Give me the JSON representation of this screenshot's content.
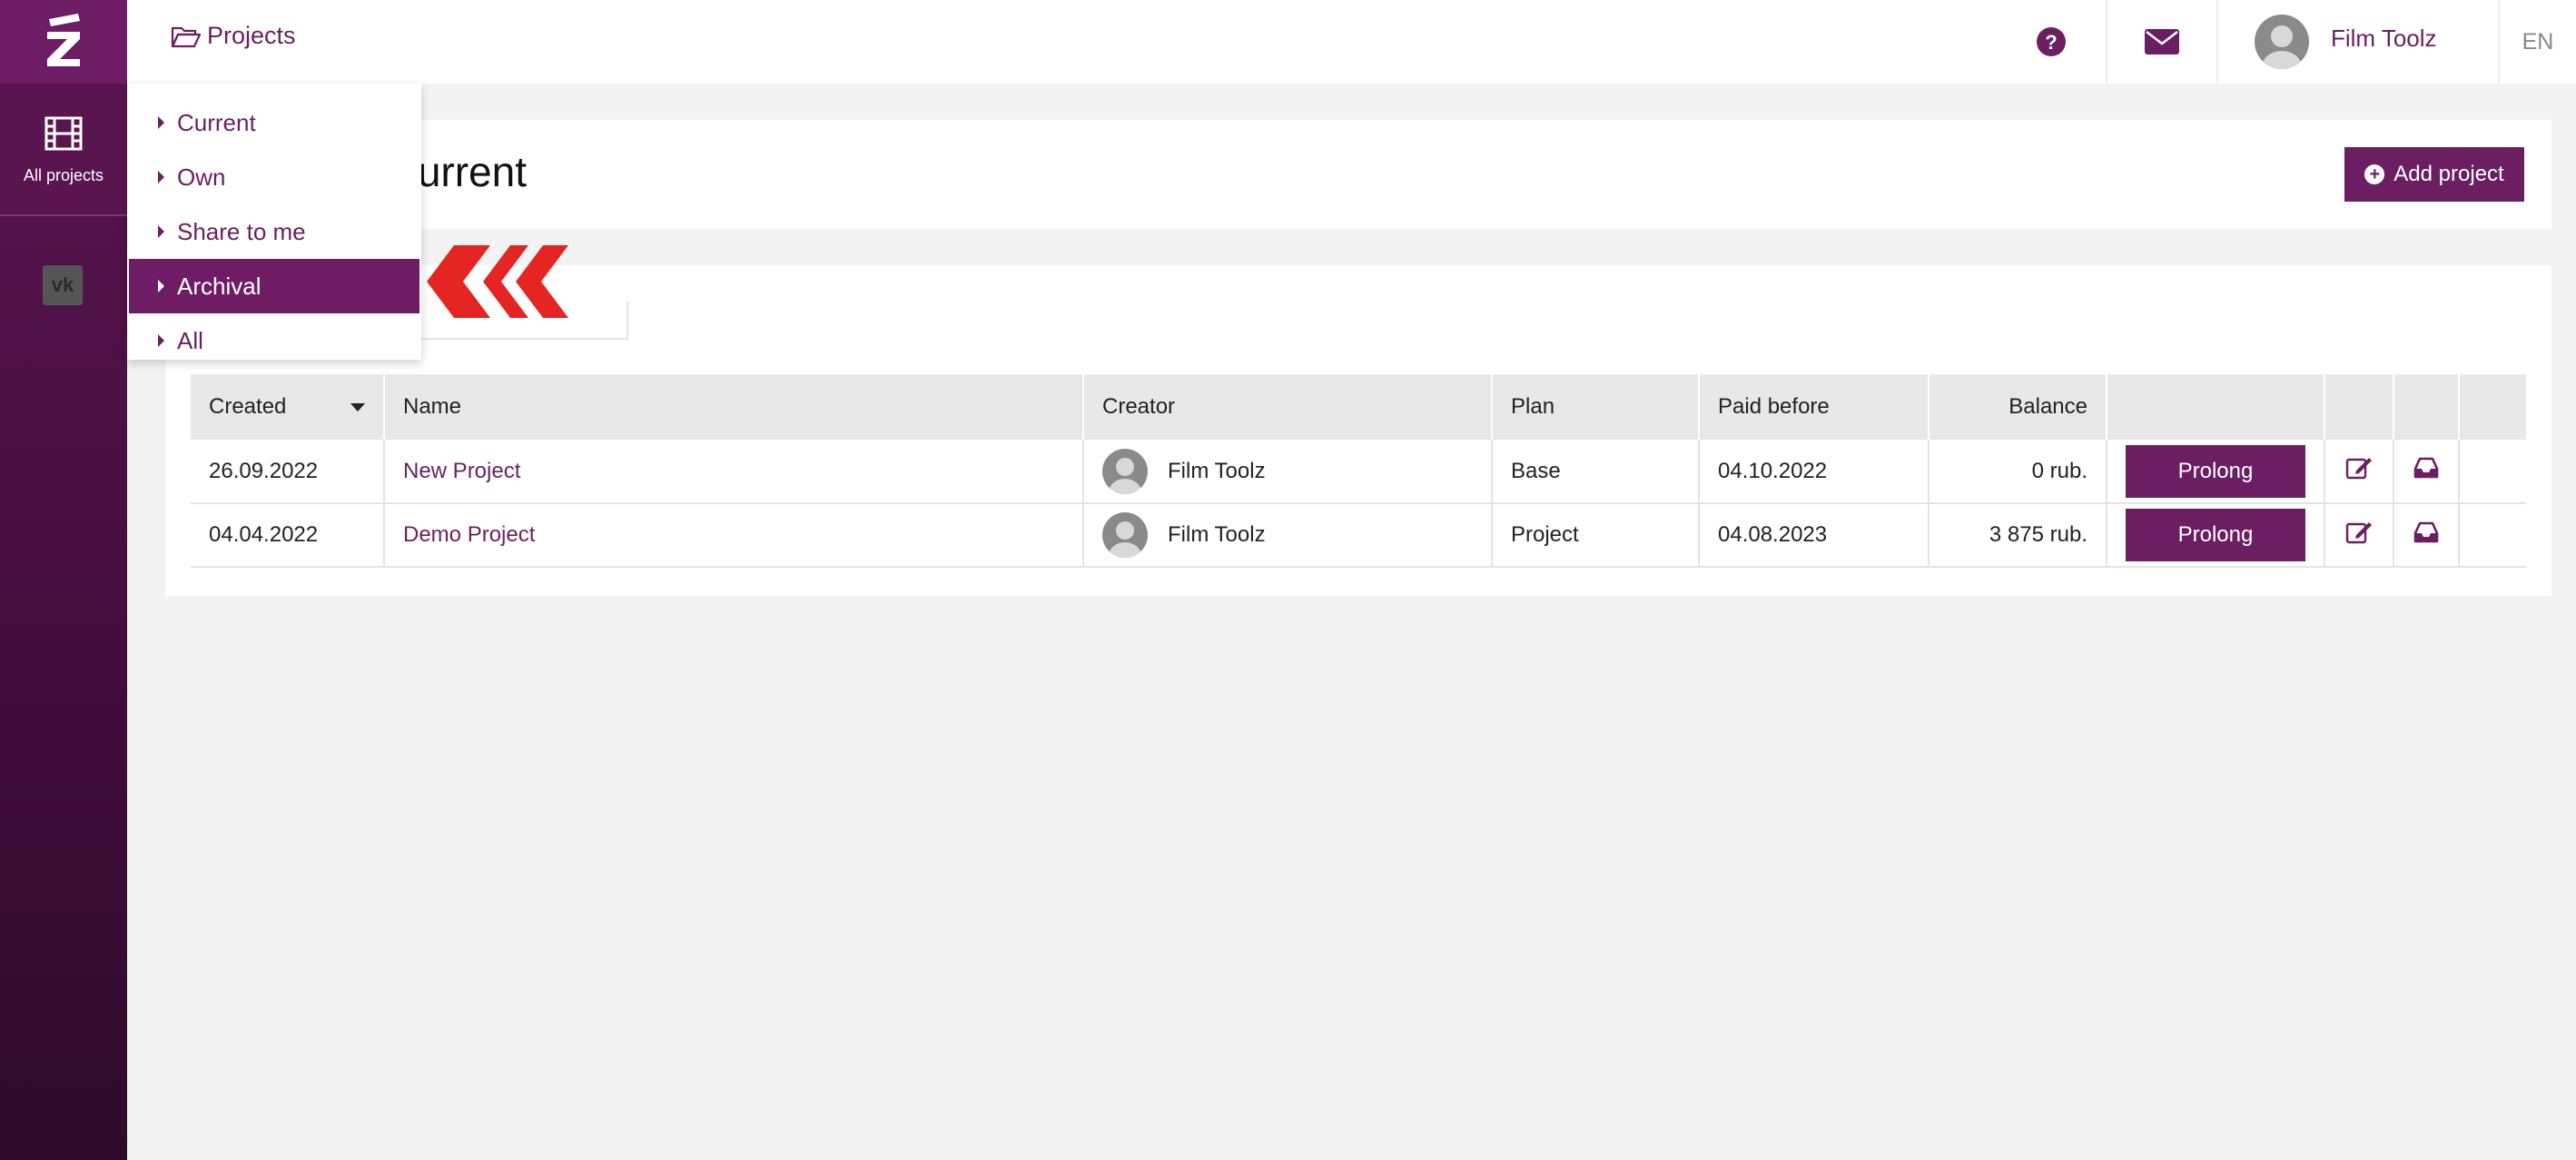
{
  "sidebar": {
    "nav_label": "All projects"
  },
  "topbar": {
    "breadcrumb": "Projects",
    "user_name": "Film Toolz",
    "language": "EN"
  },
  "page": {
    "title": "Current",
    "add_button": "Add project"
  },
  "dropdown": {
    "items": [
      "Current",
      "Own",
      "Share to me",
      "Archival",
      "All"
    ],
    "active": "Archival"
  },
  "table": {
    "headers": [
      "Created",
      "Name",
      "Creator",
      "Plan",
      "Paid before",
      "Balance"
    ],
    "rows": [
      {
        "created": "26.09.2022",
        "name": "New Project",
        "creator": "Film Toolz",
        "plan": "Base",
        "paid_before": "04.10.2022",
        "balance": "0 rub.",
        "action": "Prolong"
      },
      {
        "created": "04.04.2022",
        "name": "Demo Project",
        "creator": "Film Toolz",
        "plan": "Project",
        "paid_before": "04.08.2023",
        "balance": "3 875 rub.",
        "action": "Prolong"
      }
    ]
  },
  "colors": {
    "brand": "#6b1f62",
    "annotation_arrow": "#e52521"
  }
}
